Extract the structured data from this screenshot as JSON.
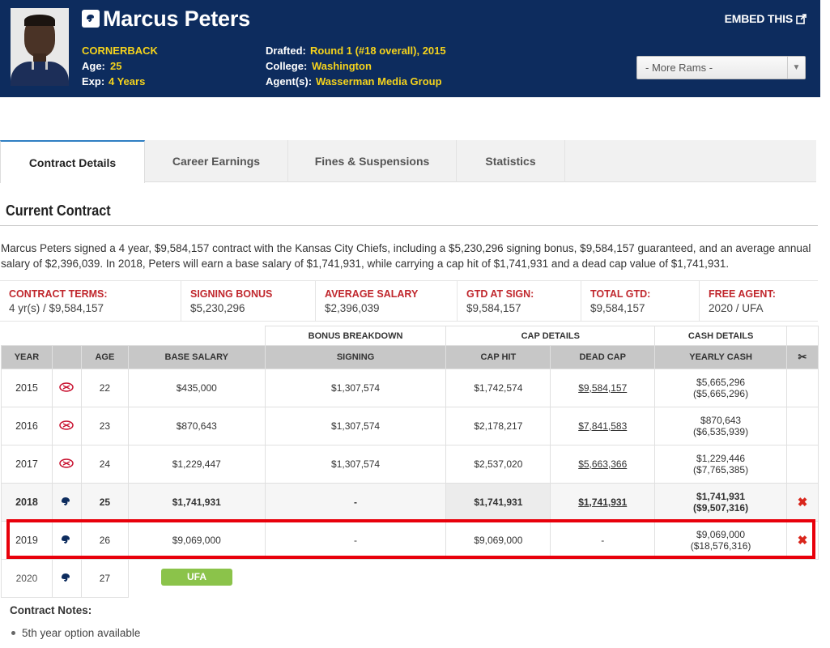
{
  "header": {
    "player_name": "Marcus Peters",
    "position": "CORNERBACK",
    "age_label": "Age:",
    "age_value": "25",
    "exp_label": "Exp:",
    "exp_value": "4 Years",
    "drafted_label": "Drafted:",
    "drafted_value": "Round 1 (#18 overall), 2015",
    "college_label": "College:",
    "college_value": "Washington",
    "agent_label": "Agent(s):",
    "agent_value": "Wasserman Media Group",
    "embed_label": "EMBED THIS",
    "team_select": "- More Rams -",
    "team_logo_icon": "rams-logo-icon",
    "colors": {
      "background": "#0d2c5e",
      "highlight": "#f5d31c"
    }
  },
  "tabs": [
    {
      "label": "Contract Details",
      "active": true
    },
    {
      "label": "Career Earnings",
      "active": false
    },
    {
      "label": "Fines & Suspensions",
      "active": false
    },
    {
      "label": "Statistics",
      "active": false
    }
  ],
  "contract": {
    "section_title": "Current Contract",
    "summary": "Marcus Peters signed a 4 year, $9,584,157 contract with the Kansas City Chiefs, including a $5,230,296 signing bonus, $9,584,157 guaranteed, and an average annual salary of $2,396,039. In 2018, Peters will earn a base salary of $1,741,931, while carrying a cap hit of $1,741,931 and a dead cap value of $1,741,931.",
    "terms": [
      {
        "label": "CONTRACT TERMS:",
        "value": "4 yr(s) / $9,584,157"
      },
      {
        "label": "SIGNING BONUS",
        "value": "$5,230,296"
      },
      {
        "label": "AVERAGE SALARY",
        "value": "$2,396,039"
      },
      {
        "label": "GTD AT SIGN:",
        "value": "$9,584,157"
      },
      {
        "label": "TOTAL GTD:",
        "value": "$9,584,157"
      },
      {
        "label": "FREE AGENT:",
        "value": "2020 / UFA"
      }
    ]
  },
  "table": {
    "groups": {
      "bonus": "BONUS BREAKDOWN",
      "cap": "CAP DETAILS",
      "cash": "CASH DETAILS"
    },
    "columns": {
      "year": "YEAR",
      "age": "AGE",
      "base": "BASE SALARY",
      "signing": "SIGNING",
      "cap_hit": "CAP HIT",
      "dead_cap": "DEAD CAP",
      "yearly_cash": "YEARLY CASH"
    },
    "rows": [
      {
        "year": "2015",
        "team": "chiefs-logo-icon",
        "age": "22",
        "base": "$435,000",
        "signing": "$1,307,574",
        "cap_hit": "$1,742,574",
        "dead_cap": "$9,584,157",
        "cash": "$5,665,296",
        "cash_cum": "($5,665,296)"
      },
      {
        "year": "2016",
        "team": "chiefs-logo-icon",
        "age": "23",
        "base": "$870,643",
        "signing": "$1,307,574",
        "cap_hit": "$2,178,217",
        "dead_cap": "$7,841,583",
        "cash": "$870,643",
        "cash_cum": "($6,535,939)"
      },
      {
        "year": "2017",
        "team": "chiefs-logo-icon",
        "age": "24",
        "base": "$1,229,447",
        "signing": "$1,307,574",
        "cap_hit": "$2,537,020",
        "dead_cap": "$5,663,366",
        "cash": "$1,229,446",
        "cash_cum": "($7,765,385)"
      },
      {
        "year": "2018",
        "team": "rams-logo-icon",
        "age": "25",
        "base": "$1,741,931",
        "signing": "-",
        "cap_hit": "$1,741,931",
        "dead_cap": "$1,741,931",
        "cash": "$1,741,931",
        "cash_cum": "($9,507,316)"
      },
      {
        "year": "2019",
        "team": "rams-logo-icon",
        "age": "26",
        "base": "$9,069,000",
        "signing": "-",
        "cap_hit": "$9,069,000",
        "dead_cap": "-",
        "cash": "$9,069,000",
        "cash_cum": "($18,576,316)"
      },
      {
        "year": "2020",
        "team": "rams-logo-icon",
        "age": "27",
        "status": "UFA"
      }
    ]
  },
  "notes": {
    "title": "Contract Notes:",
    "items": [
      "5th year option available"
    ]
  }
}
